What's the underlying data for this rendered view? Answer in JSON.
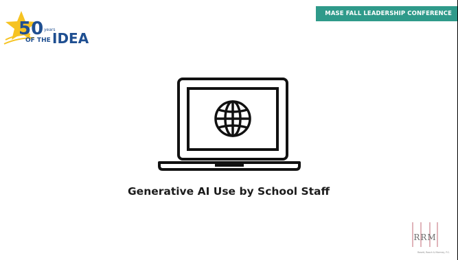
{
  "banner": {
    "text": "MASE FALL LEADERSHIP CONFERENCE"
  },
  "logo": {
    "number": "50",
    "years": "years",
    "of_the": "OF THE",
    "idea": "IDEA"
  },
  "main": {
    "title": "Generative AI Use by School Staff"
  },
  "firm_logo": {
    "letters": "RRM",
    "tagline": "Rosett, Rooch & Marmey, P.C."
  },
  "icons": {
    "laptop": "laptop-globe-icon"
  },
  "colors": {
    "banner": "#2f9a8a",
    "logo_gold": "#f6c322",
    "logo_navy": "#1f4f91",
    "firm_red": "#c06a76"
  }
}
